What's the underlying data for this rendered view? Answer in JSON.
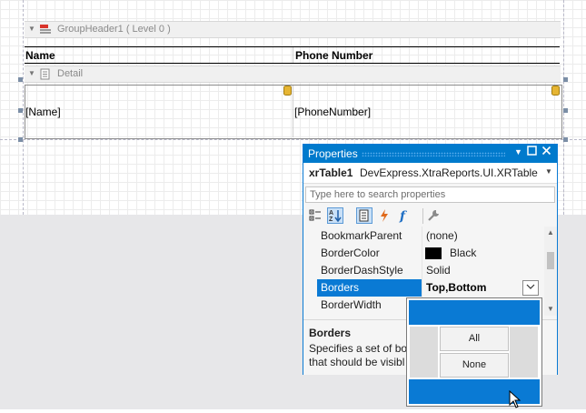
{
  "designer": {
    "group_header_label": "GroupHeader1 ( Level 0 )",
    "detail_label": "Detail",
    "header_cells": [
      "Name",
      "Phone Number"
    ],
    "data_cells": [
      "[Name]",
      "[PhoneNumber]"
    ]
  },
  "properties": {
    "title": "Properties",
    "object_name": "xrTable1",
    "object_type": "DevExpress.XtraReports.UI.XRTable",
    "search_placeholder": "Type here to search properties",
    "rows": [
      {
        "name": "BookmarkParent",
        "value": "(none)"
      },
      {
        "name": "BorderColor",
        "value": "Black",
        "color": "#000000"
      },
      {
        "name": "BorderDashStyle",
        "value": "Solid"
      },
      {
        "name": "Borders",
        "value": "Top,Bottom",
        "selected": true
      },
      {
        "name": "BorderWidth",
        "value": ""
      }
    ],
    "description_title": "Borders",
    "description_lines": [
      "Specifies a set of bor",
      "that should be visibl"
    ]
  },
  "borders_popup": {
    "all_label": "All",
    "none_label": "None",
    "top_selected": true,
    "bottom_selected": true,
    "left_selected": false,
    "right_selected": false
  },
  "colors": {
    "accent": "#007acc",
    "selection": "#0a7ad4"
  }
}
